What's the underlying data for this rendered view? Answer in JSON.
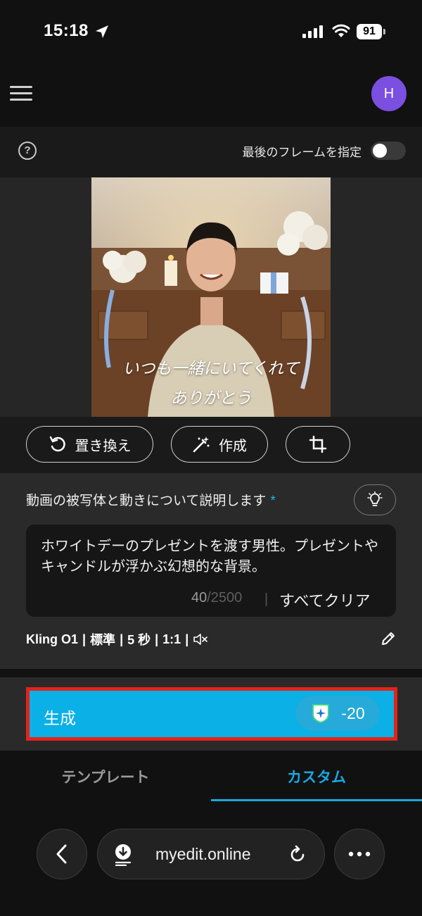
{
  "status_bar": {
    "time": "15:18",
    "battery": "91"
  },
  "header": {
    "avatar_letter": "H"
  },
  "options": {
    "help_glyph": "?",
    "last_frame_label": "最後のフレームを指定",
    "last_frame_enabled": false
  },
  "image": {
    "caption_line1": "いつも一緒にいてくれて",
    "caption_line2": "ありがとう"
  },
  "tools": {
    "replace_label": "置き換え",
    "create_label": "作成"
  },
  "prompt": {
    "title": "動画の被写体と動きについて説明します",
    "required_mark": "*",
    "text": "ホワイトデーのプレゼントを渡す男性。プレゼントやキャンドルが浮かぶ幻想的な背景。",
    "count": "40",
    "max": "/2500",
    "separator": "|",
    "clear_all": "すべてクリア"
  },
  "settings": {
    "model": "Kling O1",
    "quality": "標準",
    "duration": "5 秒",
    "ratio": "1:1",
    "separator": "|"
  },
  "generate": {
    "label": "生成",
    "cost": "-20"
  },
  "tabs": {
    "template": "テンプレート",
    "custom": "カスタム",
    "active": "custom"
  },
  "browser": {
    "url": "myedit.online"
  },
  "colors": {
    "accent": "#18a8e0",
    "generate_bg": "#0ab0e6",
    "highlight_border": "#e52219",
    "avatar_bg": "#7b4fe0"
  }
}
